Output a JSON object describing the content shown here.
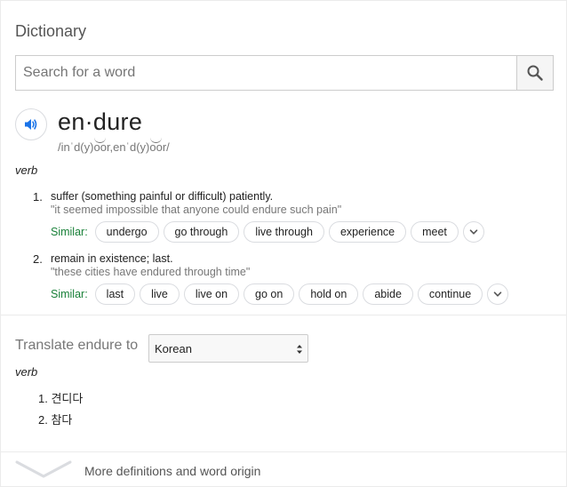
{
  "header": {
    "title": "Dictionary"
  },
  "search": {
    "placeholder": "Search for a word",
    "value": "",
    "icon": "search-icon"
  },
  "entry": {
    "headword": "en·dure",
    "phonetic": {
      "p1": "/in",
      "p2": "ˈ",
      "p3": "d(y)",
      "p4": "o",
      "p5": "o",
      "p6": "r,en",
      "p7": "ˈ",
      "p8": "d(y)",
      "p9": "o",
      "p10": "o",
      "p11": "r/"
    },
    "part_of_speech": "verb",
    "senses": [
      {
        "number": "1.",
        "definition": "suffer (something painful or difficult) patiently.",
        "example": "\"it seemed impossible that anyone could endure such pain\"",
        "similar_label": "Similar:",
        "similar": [
          "undergo",
          "go through",
          "live through",
          "experience",
          "meet"
        ]
      },
      {
        "number": "2.",
        "definition": "remain in existence; last.",
        "example": "\"these cities have endured through time\"",
        "similar_label": "Similar:",
        "similar": [
          "last",
          "live",
          "live on",
          "go on",
          "hold on",
          "abide",
          "continue"
        ]
      }
    ]
  },
  "translate": {
    "label": "Translate endure to",
    "language": "Korean",
    "part_of_speech": "verb",
    "items": [
      {
        "number": "1.",
        "text": "견디다"
      },
      {
        "number": "2.",
        "text": "참다"
      }
    ]
  },
  "footer": {
    "label": "More definitions and word origin"
  },
  "colors": {
    "similar_label": "#188038",
    "speaker": "#1a73e8",
    "chip_border": "#dadce0"
  }
}
